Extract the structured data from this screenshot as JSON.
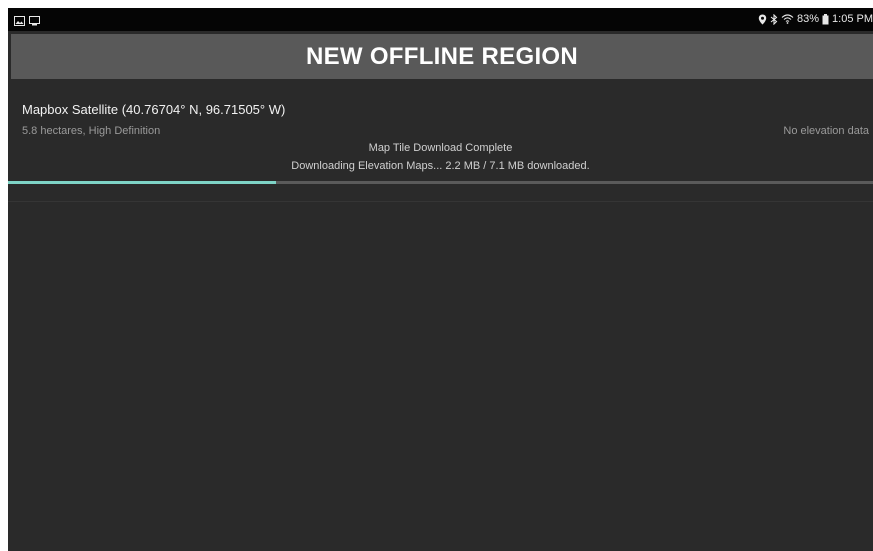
{
  "status_bar": {
    "left_icons": [
      "image-icon",
      "cast-icon"
    ],
    "right_icons": [
      "location-pin-icon",
      "bluetooth-icon",
      "wifi-icon",
      "battery-icon"
    ],
    "battery": "83%",
    "time": "1:05 PM"
  },
  "header": {
    "title": "NEW OFFLINE REGION"
  },
  "region": {
    "name": "Mapbox Satellite (40.76704° N, 96.71505° W)",
    "meta": "5.8 hectares, High Definition",
    "elevation": "No elevation data",
    "tile_status": "Map Tile Download Complete",
    "elevation_status": "Downloading Elevation Maps... 2.2 MB / 7.1 MB downloaded.",
    "progress_fraction": 0.31
  },
  "colors": {
    "background": "#2a2a2a",
    "header": "#595959",
    "accent": "#7ed3c6",
    "status_bar": "#050505"
  }
}
